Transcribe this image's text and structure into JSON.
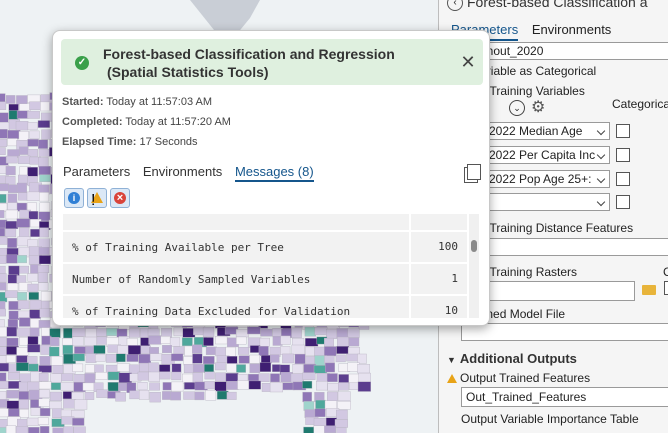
{
  "gp_pane": {
    "title": "Forest-based Classification a",
    "tabs": [
      "Parameters",
      "Environments"
    ],
    "top_field_value": "_turnout_2020",
    "treat_categorical_label": "eat Variable as Categorical",
    "explanatory_vars_label": "natory Training Variables",
    "variable_col": "le",
    "categorical_col": "Categorica",
    "variables": [
      "2022 Median Age",
      "2022 Per Capita Inc",
      "2022 Pop Age 25+:",
      ""
    ],
    "distance_features_label": "natory Training Distance Features",
    "rasters_label": "natory Training Rasters",
    "rasters_col": "C",
    "trained_model_label": "ut Trained Model File",
    "additional_outputs_label": "Additional Outputs",
    "output_trained_features_label": "Output Trained Features",
    "output_trained_features_value": "Out_Trained_Features",
    "importance_table_label": "Output Variable Importance Table"
  },
  "popup": {
    "title_line1": "Forest-based Classification and Regression",
    "title_line2": "(Spatial Statistics Tools)",
    "started_label": "Started:",
    "started_value": "Today at 11:57:03 AM",
    "completed_label": "Completed:",
    "completed_value": "Today at 11:57:20 AM",
    "elapsed_label": "Elapsed Time:",
    "elapsed_value": "17 Seconds",
    "tabs": [
      "Parameters",
      "Environments",
      "Messages (8)"
    ],
    "messages": [
      {
        "key": "% of Training Available per Tree",
        "value": "100"
      },
      {
        "key": "Number of Randomly Sampled Variables",
        "value": "1"
      },
      {
        "key": "% of Training Data Excluded for Validation",
        "value": "10"
      }
    ]
  },
  "colors": {
    "success_banner": "#dff0df",
    "accent_tab": "#15568c",
    "map_purple_dark": "#4a2a7a",
    "map_teal": "#2a8a80"
  }
}
